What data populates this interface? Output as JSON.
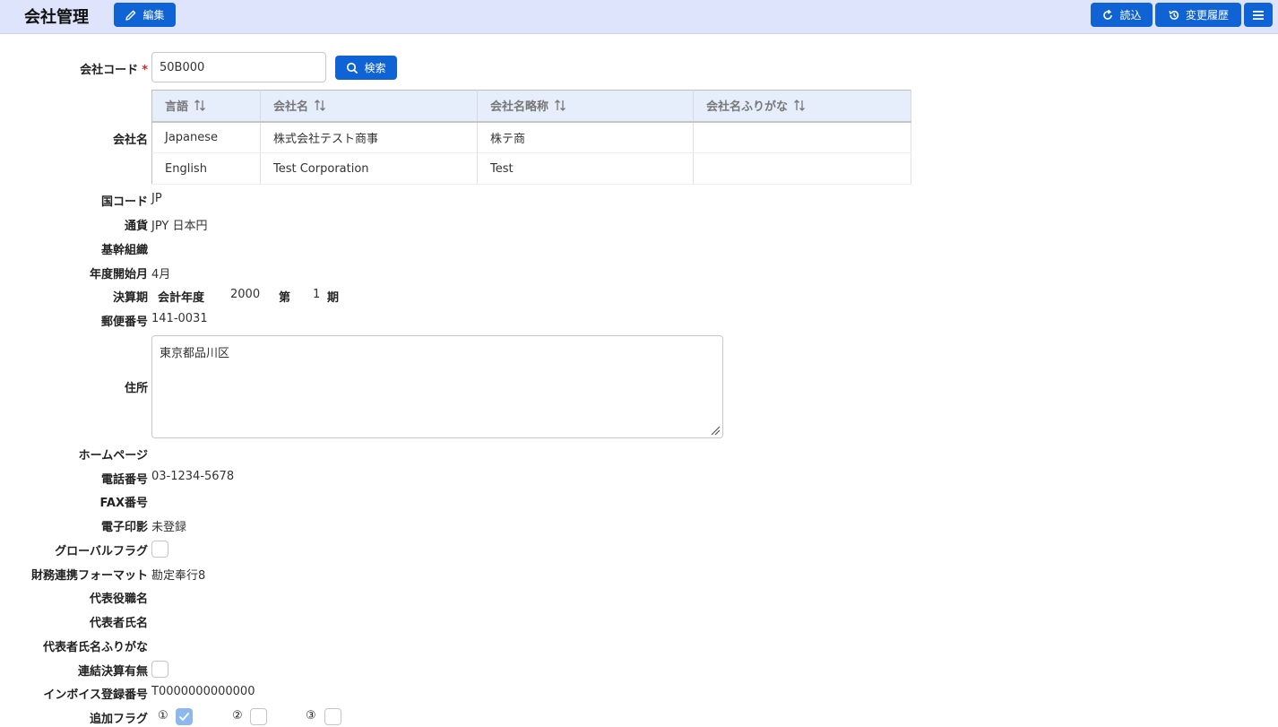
{
  "header": {
    "title": "会社管理",
    "edit_label": "編集",
    "reload_label": "読込",
    "history_label": "変更履歴"
  },
  "company_code": {
    "label": "会社コード",
    "required_mark": "*",
    "value": "50B000",
    "search_label": "検索"
  },
  "company_name": {
    "label": "会社名",
    "columns": [
      "言語",
      "会社名",
      "会社名略称",
      "会社名ふりがな"
    ],
    "rows": [
      [
        "Japanese",
        "株式会社テスト商事",
        "株テ商",
        ""
      ],
      [
        "English",
        "Test Corporation",
        "Test",
        ""
      ]
    ]
  },
  "fields": {
    "country_code_label": "国コード",
    "country_code": "JP",
    "currency_label": "通貨",
    "currency": "JPY 日本円",
    "core_org_label": "基幹組織",
    "fiscal_start_label": "年度開始月",
    "fiscal_start": "4月",
    "period_label": "決算期",
    "period_fy_label": "会計年度",
    "period_year": "2000",
    "period_no_label": "第",
    "period_no": "1",
    "period_unit": "期",
    "postal_label": "郵便番号",
    "postal": "141-0031",
    "address_label": "住所",
    "address": "東京都品川区",
    "homepage_label": "ホームページ",
    "phone_label": "電話番号",
    "phone": "03-1234-5678",
    "fax_label": "FAX番号",
    "seal_label": "電子印影",
    "seal": "未登録",
    "global_flag_label": "グローバルフラグ",
    "finance_format_label": "財務連携フォーマット",
    "finance_format": "勘定奉行8",
    "rep_title_label": "代表役職名",
    "rep_name_label": "代表者氏名",
    "rep_kana_label": "代表者氏名ふりがな",
    "consolidated_label": "連結決算有無",
    "invoice_label": "インボイス登録番号",
    "invoice": "T0000000000000",
    "extra_flag_label": "追加フラグ",
    "extra_flags": [
      {
        "mark": "①",
        "checked": true
      },
      {
        "mark": "②",
        "checked": false
      },
      {
        "mark": "③",
        "checked": false
      }
    ]
  },
  "colors": {
    "primary": "#0f63d4",
    "header_bg": "#dde4fb",
    "table_header_bg": "#e6eefc",
    "required": "#e02020"
  }
}
